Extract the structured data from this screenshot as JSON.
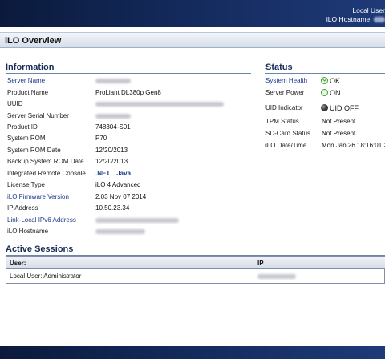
{
  "header": {
    "user_text": "Local User",
    "hostname_label": "iLO Hostname:"
  },
  "page": {
    "title": "iLO Overview"
  },
  "information": {
    "title": "Information",
    "rows": [
      {
        "label": "Server Name",
        "value": ""
      },
      {
        "label": "Product Name",
        "value": "ProLiant DL380p Gen8"
      },
      {
        "label": "UUID",
        "value": ""
      },
      {
        "label": "Server Serial Number",
        "value": ""
      },
      {
        "label": "Product ID",
        "value": "748304-S01"
      },
      {
        "label": "System ROM",
        "value": "P70"
      },
      {
        "label": "System ROM Date",
        "value": "12/20/2013"
      },
      {
        "label": "Backup System ROM Date",
        "value": "12/20/2013"
      },
      {
        "label": "Integrated Remote Console",
        "value": ""
      },
      {
        "label": "License Type",
        "value": "iLO 4 Advanced"
      },
      {
        "label": "iLO Firmware Version",
        "value": "2.03 Nov 07 2014"
      },
      {
        "label": "IP Address",
        "value": "10.50.23.34"
      },
      {
        "label": "Link-Local IPv6 Address",
        "value": ""
      },
      {
        "label": "iLO Hostname",
        "value": ""
      }
    ],
    "remote_console_links": [
      ".NET",
      "Java"
    ]
  },
  "status": {
    "title": "Status",
    "rows": [
      {
        "label": "System Health",
        "value": "OK",
        "icon": "ok-check-icon"
      },
      {
        "label": "Server Power",
        "value": "ON",
        "icon": "power-on-icon"
      },
      {
        "label": "UID Indicator",
        "value": "UID OFF",
        "icon": "uid-off-icon"
      },
      {
        "label": "TPM Status",
        "value": "Not Present"
      },
      {
        "label": "SD-Card Status",
        "value": "Not Present"
      },
      {
        "label": "iLO Date/Time",
        "value": "Mon Jan 26 18:16:01 2"
      }
    ]
  },
  "sessions": {
    "title": "Active Sessions",
    "columns": [
      "User:",
      "IP"
    ],
    "rows": [
      {
        "user": "Local User: Administrator",
        "ip": ""
      }
    ]
  },
  "colors": {
    "header_bg": "#13295a",
    "link": "#1d3a8a",
    "ok_green": "#3aa52e"
  }
}
